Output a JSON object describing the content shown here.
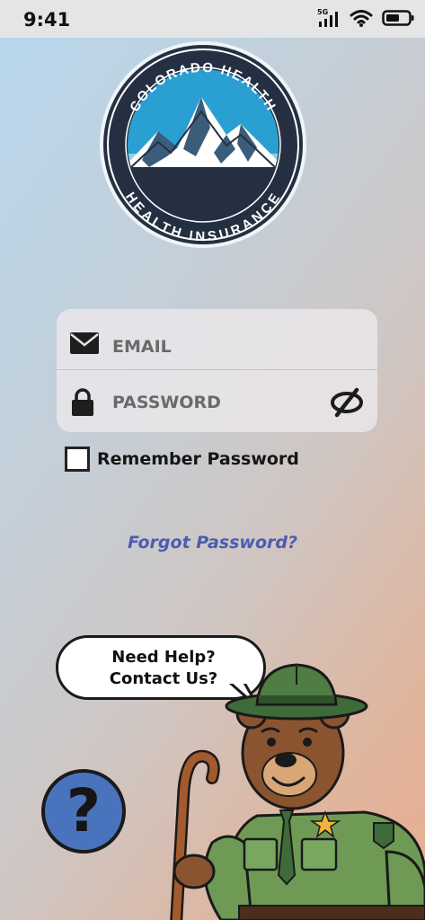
{
  "status_bar": {
    "time": "9:41",
    "network": "5G"
  },
  "logo": {
    "top_text": "COLORADO HEALTH",
    "bottom_text": "HEALTH INSURANCE"
  },
  "login": {
    "email_placeholder": "EMAIL",
    "password_placeholder": "PASSWORD",
    "remember_label": "Remember Password",
    "remember_checked": false,
    "forgot_label": "Forgot Password?"
  },
  "help": {
    "bubble_line1": "Need Help?",
    "bubble_line2": "Contact Us?",
    "button_symbol": "?"
  },
  "icons": [
    "signal-icon",
    "wifi-icon",
    "battery-icon",
    "mail-icon",
    "lock-icon",
    "eye-off-icon",
    "question-icon"
  ],
  "colors": {
    "accent": "#4d5cb0",
    "help_button": "#4a73bd",
    "logo_ring": "#243042"
  }
}
